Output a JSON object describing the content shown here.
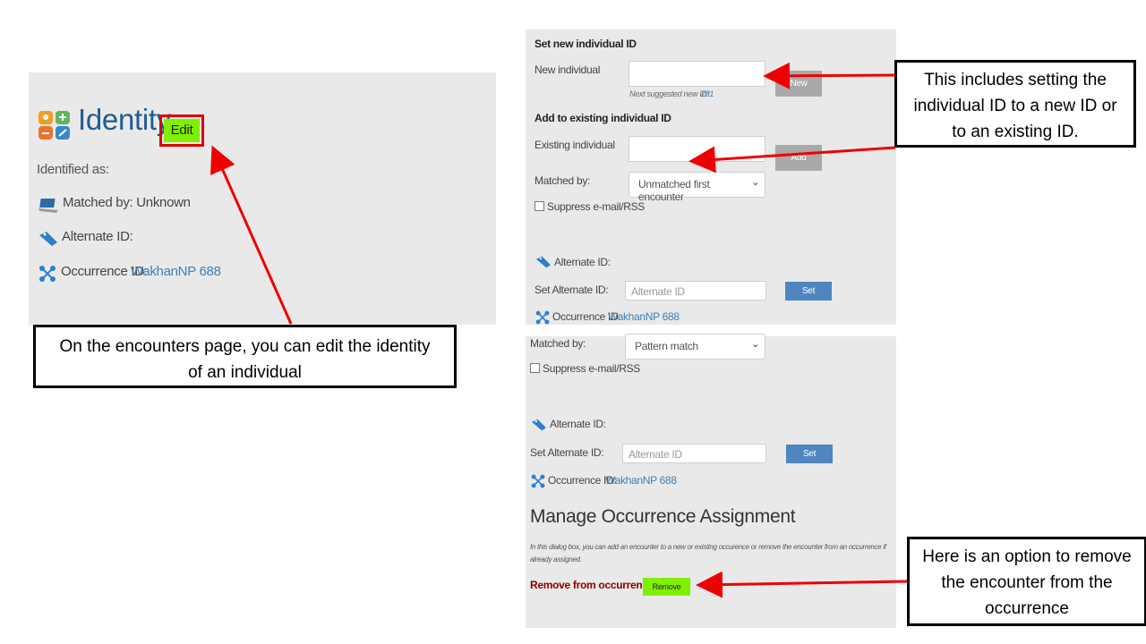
{
  "left_panel": {
    "title": "Identity",
    "edit_label": "Edit",
    "identified_as": "Identified as:",
    "matched_by": "Matched by: Unknown",
    "alternate_id": "Alternate ID:",
    "occurrence_label": "Occurrence ID:",
    "occurrence_link": "WakhanNP 688"
  },
  "right_top": {
    "set_new_heading": "Set new individual ID",
    "new_individual_label": "New individual",
    "next_suggested_label": "Next suggested new ID:",
    "next_suggested_value": "281",
    "new_button": "New",
    "add_existing_heading": "Add to existing individual ID",
    "existing_individual_label": "Existing individual",
    "add_button": "Add",
    "matched_by_label": "Matched by:",
    "matched_by_value": "Unmatched first encounter",
    "suppress_label": "Suppress e-mail/RSS",
    "alternate_id_label": "Alternate ID:",
    "set_alternate_label": "Set Alternate ID:",
    "alternate_placeholder": "Alternate ID",
    "set_button": "Set",
    "occurrence_label": "Occurrence ID:",
    "occurrence_link": "WakhanNP 688"
  },
  "right_bottom": {
    "matched_by_label": "Matched by:",
    "matched_by_value": "Pattern match",
    "suppress_label": "Suppress e-mail/RSS",
    "alternate_id_label": "Alternate ID:",
    "set_alternate_label": "Set Alternate ID:",
    "alternate_placeholder": "Alternate ID",
    "set_button": "Set",
    "occurrence_label": "Occurrence ID:",
    "occurrence_link": "WakhanNP 688",
    "manage_heading": "Manage Occurrence Assignment",
    "dialog_text": "In this dialog box, you can add an encounter to a new or existing occurence or remove the encounter from an occurrence if already assigned.",
    "remove_label": "Remove from occurrence",
    "remove_button": "Remove"
  },
  "callouts": {
    "edit_identity": "On the encounters page, you can edit the identity of an individual",
    "set_id": "This includes setting the individual ID to a new ID or to an existing ID.",
    "remove": "Here is an option to remove the encounter from the occurrence"
  },
  "colors": {
    "panel_bg": "#e9e9e9",
    "link": "#3f7fb3",
    "edit_green": "#80f000",
    "arrow_red": "#ee0000",
    "remove_label": "#8b0000"
  }
}
